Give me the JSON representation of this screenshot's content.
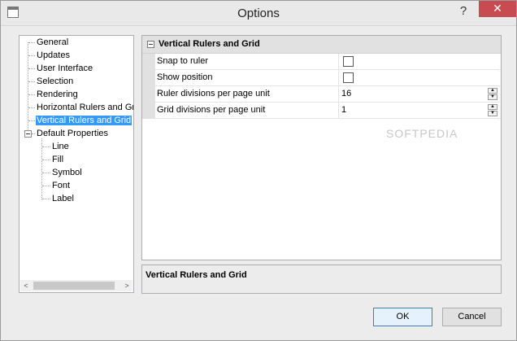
{
  "window": {
    "title": "Options",
    "help_label": "?",
    "close_label": "✕"
  },
  "tree": {
    "items": [
      {
        "label": "General"
      },
      {
        "label": "Updates"
      },
      {
        "label": "User Interface"
      },
      {
        "label": "Selection"
      },
      {
        "label": "Rendering"
      },
      {
        "label": "Horizontal Rulers and Grid"
      },
      {
        "label": "Vertical Rulers and Grid",
        "selected": true
      },
      {
        "label": "Default Properties",
        "expanded": true
      },
      {
        "label": "Line"
      },
      {
        "label": "Fill"
      },
      {
        "label": "Symbol"
      },
      {
        "label": "Font"
      },
      {
        "label": "Label"
      }
    ],
    "scroll_left": "<",
    "scroll_right": ">"
  },
  "properties": {
    "section_title": "Vertical Rulers and Grid",
    "rows": [
      {
        "name": "Snap to ruler",
        "type": "checkbox",
        "checked": false
      },
      {
        "name": "Show position",
        "type": "checkbox",
        "checked": false
      },
      {
        "name": "Ruler divisions per page unit",
        "type": "spinner",
        "value": "16"
      },
      {
        "name": "Grid divisions per page unit",
        "type": "spinner",
        "value": "1"
      }
    ]
  },
  "description": {
    "title": "Vertical Rulers and Grid"
  },
  "buttons": {
    "ok": "OK",
    "cancel": "Cancel"
  },
  "watermark": "SOFTPEDIA"
}
